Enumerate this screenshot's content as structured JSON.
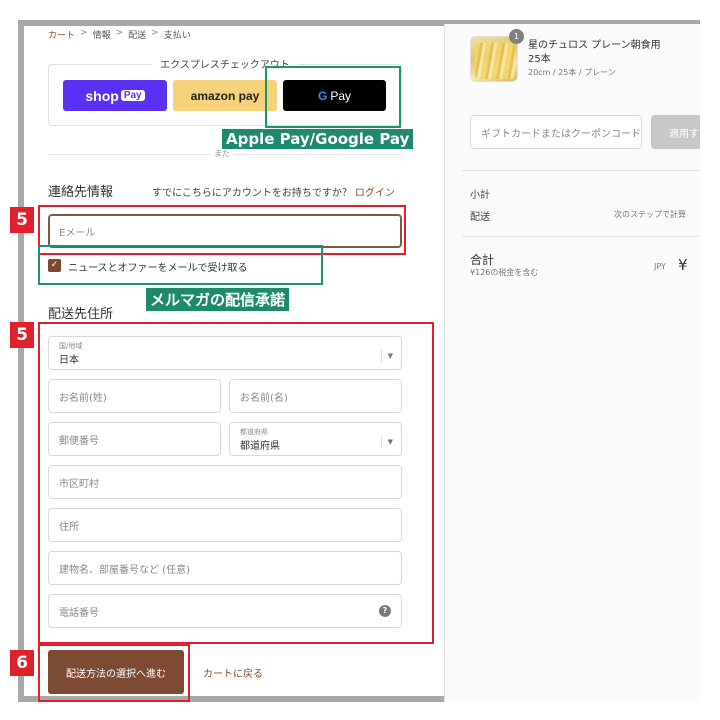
{
  "breadcrumb": [
    "カート",
    "情報",
    "配送",
    "支払い"
  ],
  "express": {
    "title": "エクスプレスチェックアウト",
    "shop_pay": {
      "shop": "shop",
      "pay": "Pay"
    },
    "amazon_pay": "amazon pay",
    "google_pay": {
      "g": "G",
      "pay": "Pay"
    },
    "or": "また"
  },
  "annotations": {
    "wallets_label": "Apple Pay/Google Pay",
    "newsletter_label": "メルマガの配信承諾",
    "step_email": "5",
    "step_address": "5",
    "step_submit": "6"
  },
  "contact": {
    "heading": "連絡先情報",
    "account_question": "すでにこちらにアカウントをお持ちですか？",
    "login_link": "ログイン",
    "email_placeholder": "Eメール",
    "newsletter_checkbox": "ニュースとオファーをメールで受け取る"
  },
  "shipping": {
    "heading": "配送先住所",
    "country_label": "国/地域",
    "country_value": "日本",
    "last_name": "お名前(姓)",
    "first_name": "お名前(名)",
    "postal_code": "郵便番号",
    "prefecture_label": "都道府県",
    "prefecture_value": "都道府県",
    "city": "市区町村",
    "address": "住所",
    "building": "建物名、部屋番号など (任意)",
    "phone": "電話番号"
  },
  "footer": {
    "submit_label": "配送方法の選択へ進む",
    "back_label": "カートに戻る"
  },
  "summary": {
    "quantity": "1",
    "product_name_line1": "星のチュロス プレーン朝食用",
    "product_name_line2": "25本",
    "product_variant": "20cm / 25本 / プレーン",
    "coupon_placeholder": "ギフトカードまたはクーポンコード",
    "apply_label": "適用す",
    "subtotal_label": "小計",
    "shipping_label": "配送",
    "shipping_value": "次のステップで計算",
    "total_label": "合計",
    "tax_note": "¥126の税金を含む",
    "currency": "JPY",
    "total_symbol": "¥"
  },
  "colors": {
    "accent": "#7d4a32",
    "annotation_green": "#1d8a6c",
    "annotation_red": "#e0202a",
    "frame": "#a8a8a8"
  }
}
